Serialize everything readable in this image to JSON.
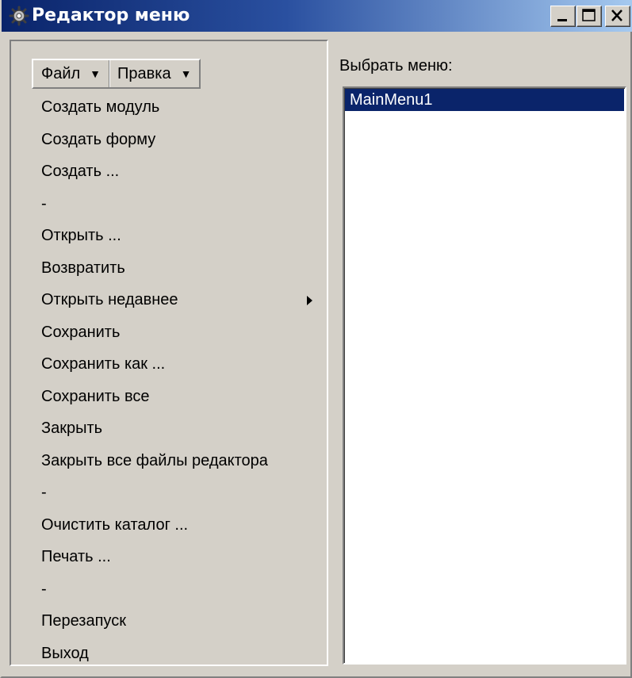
{
  "window": {
    "title": "Редактор меню",
    "buttons": [
      "minimize",
      "maximize",
      "close"
    ]
  },
  "menubar": {
    "items": [
      {
        "label": "Файл",
        "icon": "dropdown-arrow-icon"
      },
      {
        "label": "Правка",
        "icon": "dropdown-arrow-icon"
      }
    ]
  },
  "file_menu": {
    "items": [
      {
        "label": "Создать модуль"
      },
      {
        "label": "Создать форму"
      },
      {
        "label": "Создать ..."
      },
      {
        "label": "-"
      },
      {
        "label": "Открыть ..."
      },
      {
        "label": "Возвратить"
      },
      {
        "label": "Открыть недавнее",
        "has_submenu": true
      },
      {
        "label": "Сохранить"
      },
      {
        "label": "Сохранить как ..."
      },
      {
        "label": "Сохранить все"
      },
      {
        "label": "Закрыть"
      },
      {
        "label": "Закрыть все файлы редактора"
      },
      {
        "label": "-"
      },
      {
        "label": "Очистить каталог ..."
      },
      {
        "label": "Печать ..."
      },
      {
        "label": "-"
      },
      {
        "label": "Перезапуск"
      },
      {
        "label": "Выход"
      }
    ]
  },
  "menu_selector": {
    "label": "Выбрать меню:",
    "items": [
      {
        "label": "MainMenu1",
        "selected": true
      }
    ]
  },
  "colors": {
    "titlebar_start": "#0a246a",
    "titlebar_end": "#a6caf0",
    "face": "#d4d0c8",
    "selection": "#0a246a"
  }
}
